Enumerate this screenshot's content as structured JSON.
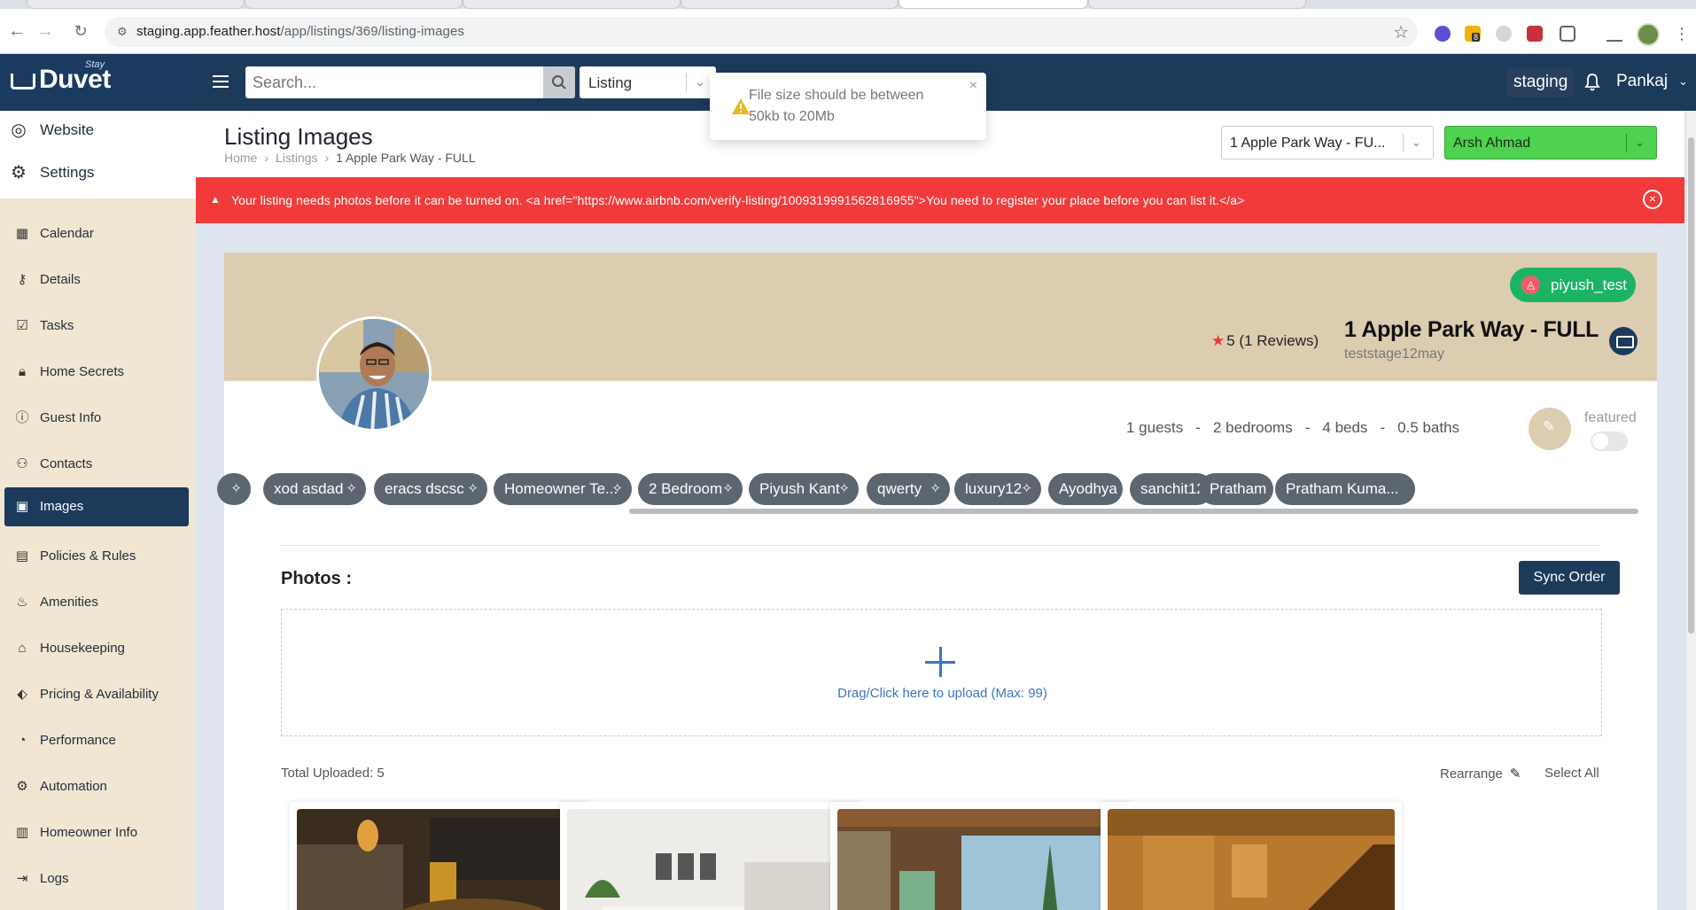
{
  "browser": {
    "url_host": "staging.app.feather.host",
    "url_path": "/app/listings/369/listing-images",
    "extension_badge": "8"
  },
  "topnav": {
    "logo_text": "Duvet",
    "logo_sub": "Stay",
    "search_placeholder": "Search...",
    "search_type": "Listing",
    "environment": "staging",
    "user_name": "Pankaj"
  },
  "toast": {
    "message": "File size should be between 50kb to 20Mb",
    "close": "×"
  },
  "sidebar": {
    "top_items": [
      {
        "label": "Website",
        "icon": "globe-icon"
      },
      {
        "label": "Settings",
        "icon": "gear-icon"
      }
    ],
    "items": [
      {
        "label": "Calendar",
        "icon": "calendar-icon"
      },
      {
        "label": "Details",
        "icon": "key-icon"
      },
      {
        "label": "Tasks",
        "icon": "tasks-icon"
      },
      {
        "label": "Home Secrets",
        "icon": "lock-icon"
      },
      {
        "label": "Guest Info",
        "icon": "info-icon"
      },
      {
        "label": "Contacts",
        "icon": "contacts-icon"
      },
      {
        "label": "Images",
        "icon": "images-icon",
        "active": true
      },
      {
        "label": "Policies & Rules",
        "icon": "policy-icon"
      },
      {
        "label": "Amenities",
        "icon": "amenities-icon"
      },
      {
        "label": "Housekeeping",
        "icon": "housekeeping-icon"
      },
      {
        "label": "Pricing & Availability",
        "icon": "tag-icon"
      },
      {
        "label": "Performance",
        "icon": "gauge-icon"
      },
      {
        "label": "Automation",
        "icon": "automation-icon"
      },
      {
        "label": "Homeowner Info",
        "icon": "homeowner-icon"
      },
      {
        "label": "Logs",
        "icon": "logs-icon"
      }
    ]
  },
  "header": {
    "title": "Listing Images",
    "breadcrumbs": [
      "Home",
      "Listings",
      "1 Apple Park Way - FULL"
    ],
    "listing_select": "1 Apple Park Way - FU...",
    "owner_select": "Arsh Ahmad"
  },
  "alert": {
    "text": "Your listing needs photos before it can be turned on. <a href=\"https://www.airbnb.com/verify-listing/1009319991562816955\">You need to register your place before you can list it.</a>",
    "color": "#f13b3b"
  },
  "listing": {
    "channel_user": "piyush_test",
    "rating": "5 (1 Reviews)",
    "name": "1 Apple Park Way - FULL",
    "username": "teststage12may",
    "guests": "1 guests",
    "bedrooms": "2 bedrooms",
    "beds": "4 beds",
    "baths": "0.5 baths",
    "featured_label": "featured",
    "featured_on": false
  },
  "tags": [
    "",
    "xod asdad",
    "eracs dscsc",
    "Homeowner Te...",
    "2 Bedroom",
    "Piyush Kant",
    "qwerty",
    "luxury12",
    "Ayodhya",
    "sanchit12",
    "Pratham",
    "Pratham Kuma..."
  ],
  "photos": {
    "title": "Photos :",
    "sync_label": "Sync Order",
    "upload_hint": "Drag/Click here to upload (Max: 99)",
    "total_uploaded": "Total Uploaded: 5",
    "rearrange_label": "Rearrange",
    "select_all_label": "Select All"
  },
  "colors": {
    "navy": "#1c3a5a",
    "sidebar_bg": "#f1e6d1",
    "banner_bg": "#ddcdb0",
    "owner_green": "#4fd24f",
    "channel_green": "#1bb464",
    "link_blue": "#3a75c4"
  }
}
